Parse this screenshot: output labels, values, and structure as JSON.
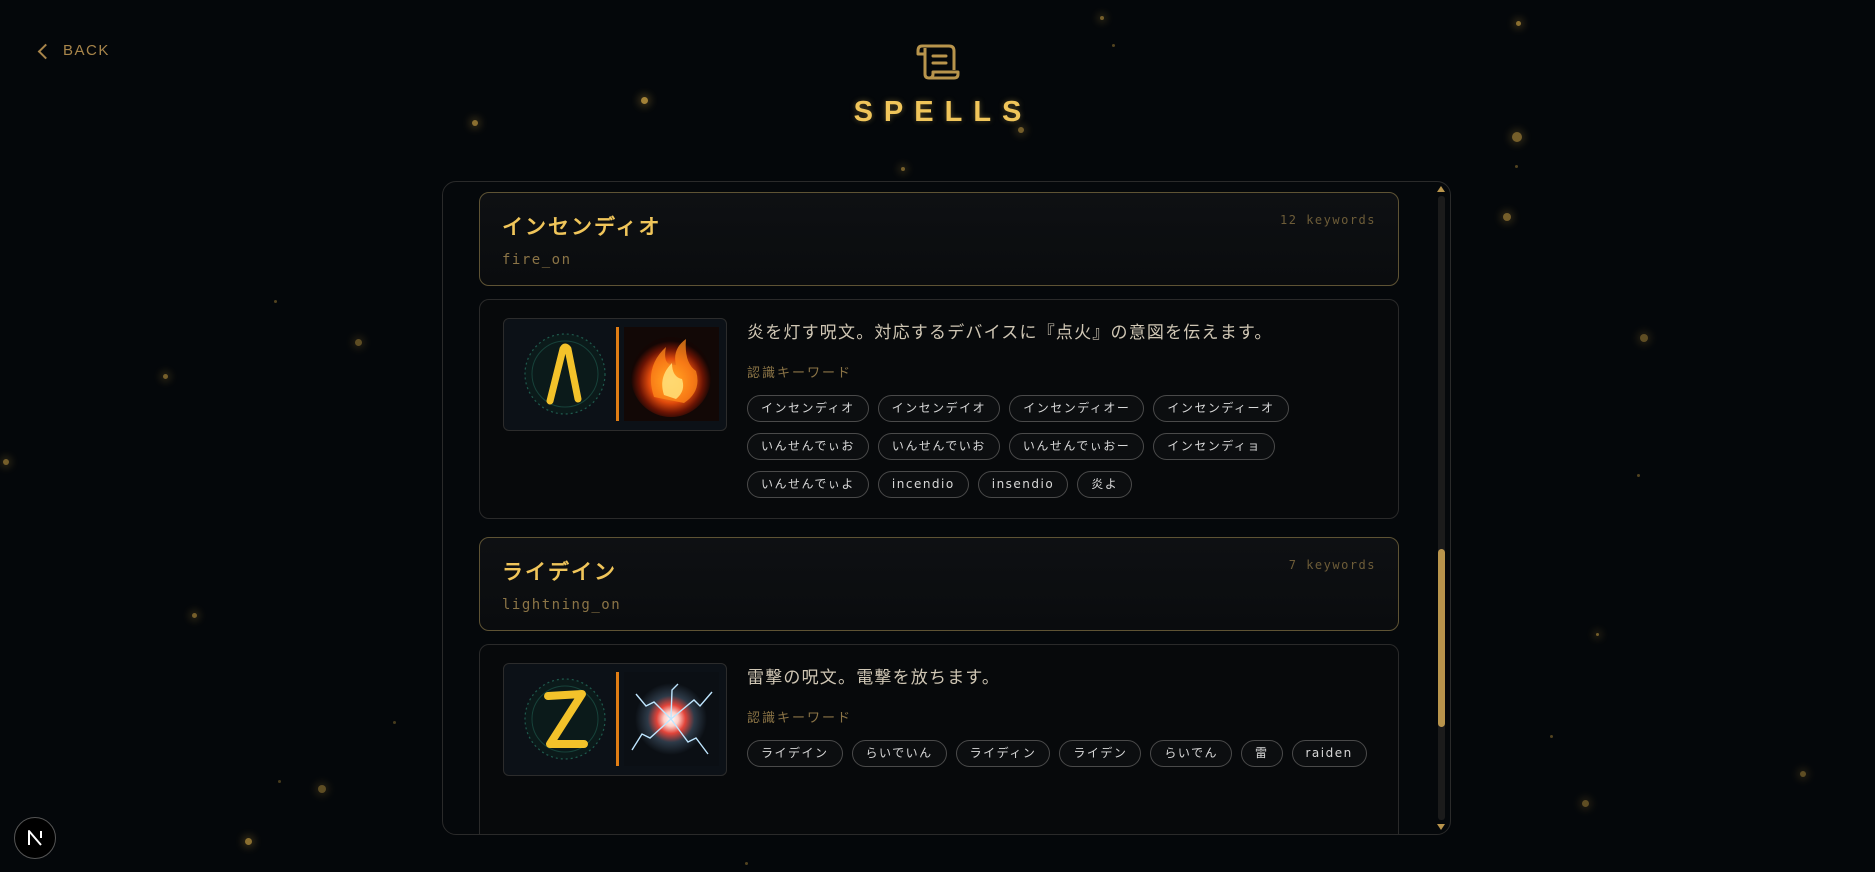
{
  "nav": {
    "back_label": "BACK"
  },
  "page": {
    "title": "SPELLS",
    "icon": "scroll-icon"
  },
  "spells": [
    {
      "name": "インセンディオ",
      "id": "fire_on",
      "count": "12 keywords",
      "description": "炎を灯す呪文。対応するデバイスに『点火』の意図を伝えます。",
      "keyword_label": "認識キーワード",
      "rune": "fire-rune-icon",
      "effect": "fire-effect-image",
      "keywords": [
        "インセンディオ",
        "インセンデイオ",
        "インセンディオー",
        "インセンディーオ",
        "いんせんでぃお",
        "いんせんでいお",
        "いんせんでぃおー",
        "インセンディョ",
        "いんせんでぃよ",
        "incendio",
        "insendio",
        "炎よ"
      ]
    },
    {
      "name": "ライデイン",
      "id": "lightning_on",
      "count": "7 keywords",
      "description": "雷撃の呪文。電撃を放ちます。",
      "keyword_label": "認識キーワード",
      "rune": "lightning-rune-icon",
      "effect": "lightning-effect-image",
      "keywords": [
        "ライデイン",
        "らいでいん",
        "ライディン",
        "ライデン",
        "らいでん",
        "雷",
        "raiden"
      ]
    }
  ],
  "colors": {
    "accent": "#f0c55a",
    "muted_gold": "#8b7446",
    "background": "#04070a",
    "divider": "#e07d14"
  }
}
